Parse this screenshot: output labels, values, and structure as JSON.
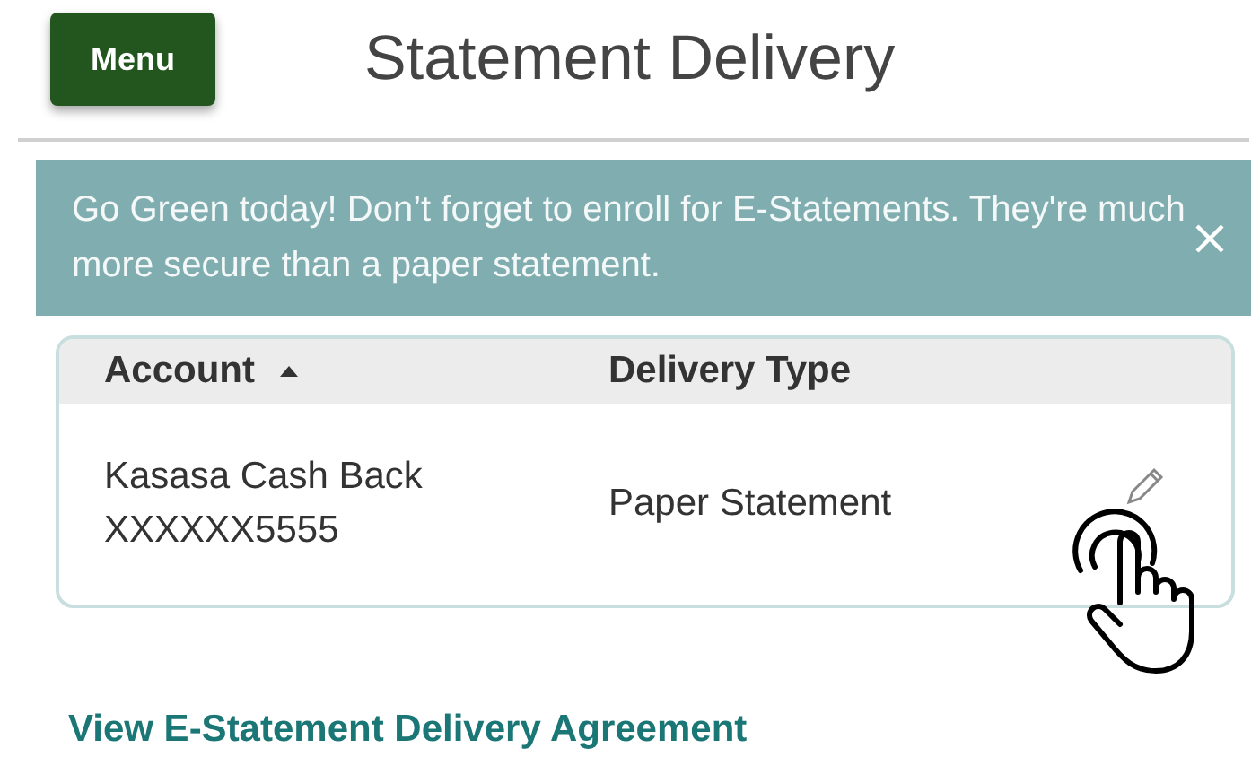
{
  "menu_button": {
    "label": "Menu"
  },
  "title": "Statement Delivery",
  "banner": {
    "message": "Go Green today! Don’t forget to enroll for E-Statements. They're much more secure than a paper statement."
  },
  "table": {
    "columns": [
      "Account",
      "Delivery Type"
    ],
    "rows": [
      {
        "account_name": "Kasasa Cash Back",
        "account_number": "XXXXXX5555",
        "delivery_type": "Paper Statement"
      }
    ]
  },
  "agreement_link": "View E-Statement Delivery Agreement"
}
